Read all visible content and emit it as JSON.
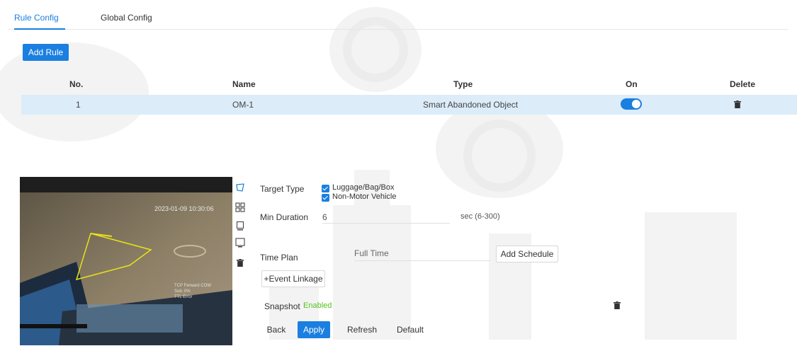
{
  "tabs": [
    {
      "label": "Rule Config",
      "active": true
    },
    {
      "label": "Global Config",
      "active": false
    }
  ],
  "add_rule_label": "Add Rule",
  "table": {
    "headers": {
      "no": "No.",
      "name": "Name",
      "type": "Type",
      "on": "On",
      "delete": "Delete"
    },
    "rows": [
      {
        "no": "1",
        "name": "OM-1",
        "type": "Smart Abandoned Object",
        "on": true
      }
    ]
  },
  "video": {
    "timestamp": "2023-01-09 10:30:06",
    "osd_lines": [
      "TCP Ferward COW",
      "Sub: 0%",
      "TTL Error"
    ]
  },
  "tools": [
    "draw-rule-icon",
    "draw-target-filter-icon",
    "draw-min-size-icon",
    "draw-max-size-icon",
    "delete-icon"
  ],
  "form": {
    "target_type_label": "Target Type",
    "target_options": [
      {
        "label": "Luggage/Bag/Box",
        "checked": true
      },
      {
        "label": "Non-Motor Vehicle",
        "checked": true
      }
    ],
    "min_duration_label": "Min Duration",
    "min_duration_value": "6",
    "min_duration_unit": "sec (6-300)",
    "time_plan_label": "Time Plan",
    "time_plan_value": "Full Time",
    "add_schedule_label": "Add Schedule",
    "event_linkage_label": "+Event Linkage",
    "snapshot_label": "Snapshot",
    "snapshot_status": "Enabled"
  },
  "footer": {
    "back": "Back",
    "apply": "Apply",
    "refresh": "Refresh",
    "default": "Default"
  },
  "colors": {
    "accent": "#1a7fe0",
    "row_highlight": "#dcecf9",
    "enabled_green": "#52c41a"
  }
}
